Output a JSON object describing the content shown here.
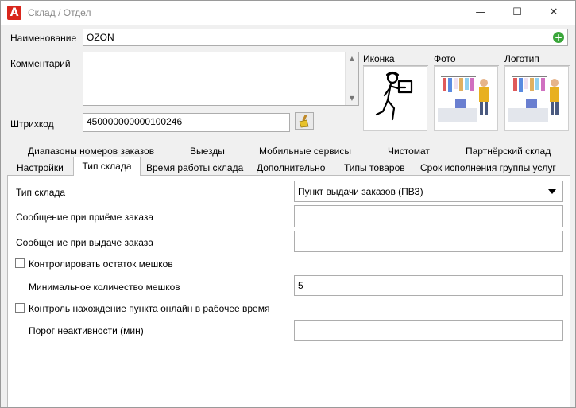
{
  "window": {
    "title": "Склад / Отдел",
    "app_logo_letter": "A",
    "min_glyph": "—",
    "max_glyph": "☐",
    "close_glyph": "✕"
  },
  "form": {
    "name_label": "Наименование",
    "name_value": "OZON",
    "comment_label": "Комментарий",
    "comment_value": "",
    "barcode_label": "Штрихкод",
    "barcode_value": "450000000000100246"
  },
  "images": {
    "icon_label": "Иконка",
    "photo_label": "Фото",
    "logo_label": "Логотип"
  },
  "tabs": {
    "row1": [
      "Диапазоны номеров заказов",
      "Выезды",
      "Мобильные сервисы",
      "Чистомат",
      "Партнёрский склад"
    ],
    "row2": [
      "Настройки",
      "Тип склада",
      "Время работы склада",
      "Дополнительно",
      "Типы товаров",
      "Срок исполнения группы услуг"
    ]
  },
  "panel": {
    "warehouse_type_label": "Тип склада",
    "warehouse_type_value": "Пункт выдачи заказов (ПВЗ)",
    "accept_msg_label": "Сообщение при приёме заказа",
    "accept_msg_value": "",
    "issue_msg_label": "Сообщение при выдаче заказа",
    "issue_msg_value": "",
    "bags_check_label": "Контролировать остаток мешков",
    "min_bags_label": "Минимальное количество мешков",
    "min_bags_value": "5",
    "online_check_label": "Контроль нахождение пункта онлайн в рабочее время",
    "inactivity_label": "Порог неактивности (мин)",
    "inactivity_value": ""
  }
}
